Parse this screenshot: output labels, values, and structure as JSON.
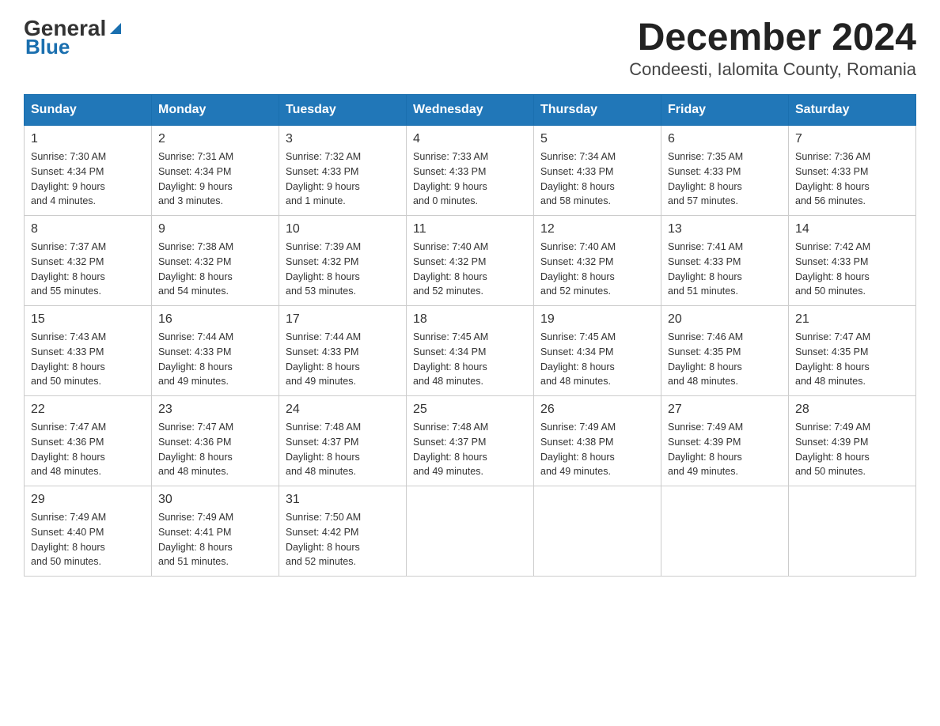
{
  "header": {
    "logo": {
      "general": "General",
      "blue": "Blue",
      "underline": "Blue"
    },
    "title": "December 2024",
    "subtitle": "Condeesti, Ialomita County, Romania"
  },
  "calendar": {
    "columns": [
      "Sunday",
      "Monday",
      "Tuesday",
      "Wednesday",
      "Thursday",
      "Friday",
      "Saturday"
    ],
    "weeks": [
      [
        {
          "day": "1",
          "info": "Sunrise: 7:30 AM\nSunset: 4:34 PM\nDaylight: 9 hours\nand 4 minutes."
        },
        {
          "day": "2",
          "info": "Sunrise: 7:31 AM\nSunset: 4:34 PM\nDaylight: 9 hours\nand 3 minutes."
        },
        {
          "day": "3",
          "info": "Sunrise: 7:32 AM\nSunset: 4:33 PM\nDaylight: 9 hours\nand 1 minute."
        },
        {
          "day": "4",
          "info": "Sunrise: 7:33 AM\nSunset: 4:33 PM\nDaylight: 9 hours\nand 0 minutes."
        },
        {
          "day": "5",
          "info": "Sunrise: 7:34 AM\nSunset: 4:33 PM\nDaylight: 8 hours\nand 58 minutes."
        },
        {
          "day": "6",
          "info": "Sunrise: 7:35 AM\nSunset: 4:33 PM\nDaylight: 8 hours\nand 57 minutes."
        },
        {
          "day": "7",
          "info": "Sunrise: 7:36 AM\nSunset: 4:33 PM\nDaylight: 8 hours\nand 56 minutes."
        }
      ],
      [
        {
          "day": "8",
          "info": "Sunrise: 7:37 AM\nSunset: 4:32 PM\nDaylight: 8 hours\nand 55 minutes."
        },
        {
          "day": "9",
          "info": "Sunrise: 7:38 AM\nSunset: 4:32 PM\nDaylight: 8 hours\nand 54 minutes."
        },
        {
          "day": "10",
          "info": "Sunrise: 7:39 AM\nSunset: 4:32 PM\nDaylight: 8 hours\nand 53 minutes."
        },
        {
          "day": "11",
          "info": "Sunrise: 7:40 AM\nSunset: 4:32 PM\nDaylight: 8 hours\nand 52 minutes."
        },
        {
          "day": "12",
          "info": "Sunrise: 7:40 AM\nSunset: 4:32 PM\nDaylight: 8 hours\nand 52 minutes."
        },
        {
          "day": "13",
          "info": "Sunrise: 7:41 AM\nSunset: 4:33 PM\nDaylight: 8 hours\nand 51 minutes."
        },
        {
          "day": "14",
          "info": "Sunrise: 7:42 AM\nSunset: 4:33 PM\nDaylight: 8 hours\nand 50 minutes."
        }
      ],
      [
        {
          "day": "15",
          "info": "Sunrise: 7:43 AM\nSunset: 4:33 PM\nDaylight: 8 hours\nand 50 minutes."
        },
        {
          "day": "16",
          "info": "Sunrise: 7:44 AM\nSunset: 4:33 PM\nDaylight: 8 hours\nand 49 minutes."
        },
        {
          "day": "17",
          "info": "Sunrise: 7:44 AM\nSunset: 4:33 PM\nDaylight: 8 hours\nand 49 minutes."
        },
        {
          "day": "18",
          "info": "Sunrise: 7:45 AM\nSunset: 4:34 PM\nDaylight: 8 hours\nand 48 minutes."
        },
        {
          "day": "19",
          "info": "Sunrise: 7:45 AM\nSunset: 4:34 PM\nDaylight: 8 hours\nand 48 minutes."
        },
        {
          "day": "20",
          "info": "Sunrise: 7:46 AM\nSunset: 4:35 PM\nDaylight: 8 hours\nand 48 minutes."
        },
        {
          "day": "21",
          "info": "Sunrise: 7:47 AM\nSunset: 4:35 PM\nDaylight: 8 hours\nand 48 minutes."
        }
      ],
      [
        {
          "day": "22",
          "info": "Sunrise: 7:47 AM\nSunset: 4:36 PM\nDaylight: 8 hours\nand 48 minutes."
        },
        {
          "day": "23",
          "info": "Sunrise: 7:47 AM\nSunset: 4:36 PM\nDaylight: 8 hours\nand 48 minutes."
        },
        {
          "day": "24",
          "info": "Sunrise: 7:48 AM\nSunset: 4:37 PM\nDaylight: 8 hours\nand 48 minutes."
        },
        {
          "day": "25",
          "info": "Sunrise: 7:48 AM\nSunset: 4:37 PM\nDaylight: 8 hours\nand 49 minutes."
        },
        {
          "day": "26",
          "info": "Sunrise: 7:49 AM\nSunset: 4:38 PM\nDaylight: 8 hours\nand 49 minutes."
        },
        {
          "day": "27",
          "info": "Sunrise: 7:49 AM\nSunset: 4:39 PM\nDaylight: 8 hours\nand 49 minutes."
        },
        {
          "day": "28",
          "info": "Sunrise: 7:49 AM\nSunset: 4:39 PM\nDaylight: 8 hours\nand 50 minutes."
        }
      ],
      [
        {
          "day": "29",
          "info": "Sunrise: 7:49 AM\nSunset: 4:40 PM\nDaylight: 8 hours\nand 50 minutes."
        },
        {
          "day": "30",
          "info": "Sunrise: 7:49 AM\nSunset: 4:41 PM\nDaylight: 8 hours\nand 51 minutes."
        },
        {
          "day": "31",
          "info": "Sunrise: 7:50 AM\nSunset: 4:42 PM\nDaylight: 8 hours\nand 52 minutes."
        },
        null,
        null,
        null,
        null
      ]
    ]
  }
}
